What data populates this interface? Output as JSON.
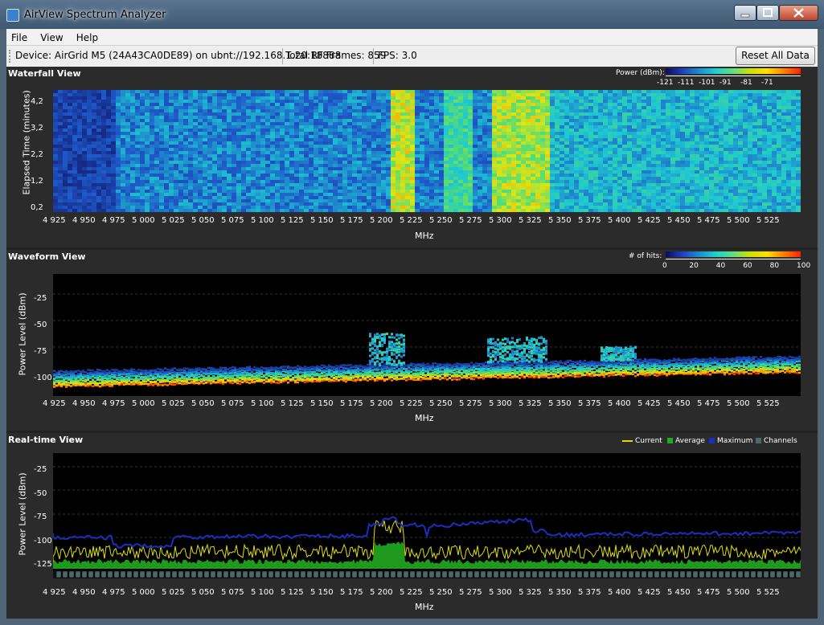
{
  "window": {
    "title": "AirView Spectrum Analyzer"
  },
  "menu": {
    "items": [
      "File",
      "View",
      "Help"
    ]
  },
  "toolbar": {
    "device": "Device: AirGrid M5 (24A43CA0DE89) on ubnt://192.168.1.20:18888",
    "frames": "Total RF Frames: 859",
    "fps": "FPS: 3.0",
    "reset_label": "Reset All Data"
  },
  "x_ticks": [
    "4 925",
    "4 950",
    "4 975",
    "5 000",
    "5 025",
    "5 050",
    "5 075",
    "5 100",
    "5 125",
    "5 150",
    "5 175",
    "5 200",
    "5 225",
    "5 250",
    "5 275",
    "5 300",
    "5 325",
    "5 350",
    "5 375",
    "5 400",
    "5 425",
    "5 450",
    "5 475",
    "5 500",
    "5 525"
  ],
  "waterfall": {
    "title": "Waterfall View",
    "legend_title": "Power (dBm):",
    "legend_ticks": [
      "-121",
      "-111",
      "-101",
      "-91",
      "-81",
      "-71"
    ],
    "ylabel": "Elapsed Time (minutes)",
    "y_ticks": [
      "4,2",
      "3,2",
      "2,2",
      "1,2",
      "0,2"
    ],
    "xlabel": "MHz"
  },
  "waveform": {
    "title": "Waveform View",
    "legend_title": "# of hits:",
    "legend_ticks": [
      "0",
      "20",
      "40",
      "60",
      "80",
      "100"
    ],
    "ylabel": "Power Level (dBm)",
    "y_ticks": [
      "-25",
      "-50",
      "-75",
      "-100"
    ],
    "xlabel": "MHz"
  },
  "realtime": {
    "title": "Real-time View",
    "legend": {
      "current": "Current",
      "average": "Average",
      "maximum": "Maximum",
      "channels": "Channels"
    },
    "ylabel": "Power Level (dBm)",
    "y_ticks": [
      "-25",
      "-50",
      "-75",
      "-100",
      "-125"
    ],
    "xlabel": "MHz"
  },
  "colors": {
    "current": "#e0e000",
    "average": "#22aa22",
    "maximum": "#1a2fc0",
    "channels": "#4a6a6a"
  }
}
